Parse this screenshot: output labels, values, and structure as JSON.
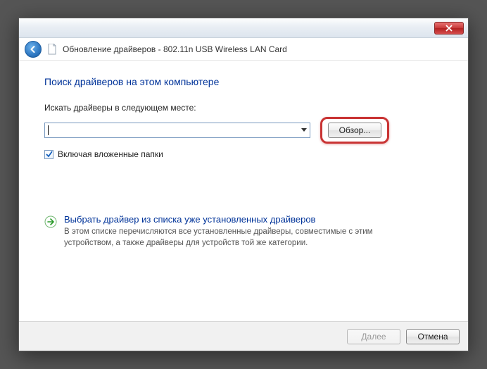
{
  "window": {
    "title": "Обновление драйверов - 802.11n USB Wireless LAN Card"
  },
  "content": {
    "heading": "Поиск драйверов на этом компьютере",
    "path_label": "Искать драйверы в следующем месте:",
    "path_value": "",
    "browse_label": "Обзор...",
    "include_subfolders_label": "Включая вложенные папки",
    "include_subfolders_checked": true,
    "option": {
      "title": "Выбрать драйвер из списка уже установленных драйверов",
      "desc": "В этом списке перечисляются все установленные драйверы, совместимые с этим устройством, а также драйверы для устройств той же категории."
    }
  },
  "footer": {
    "next_label": "Далее",
    "cancel_label": "Отмена"
  }
}
